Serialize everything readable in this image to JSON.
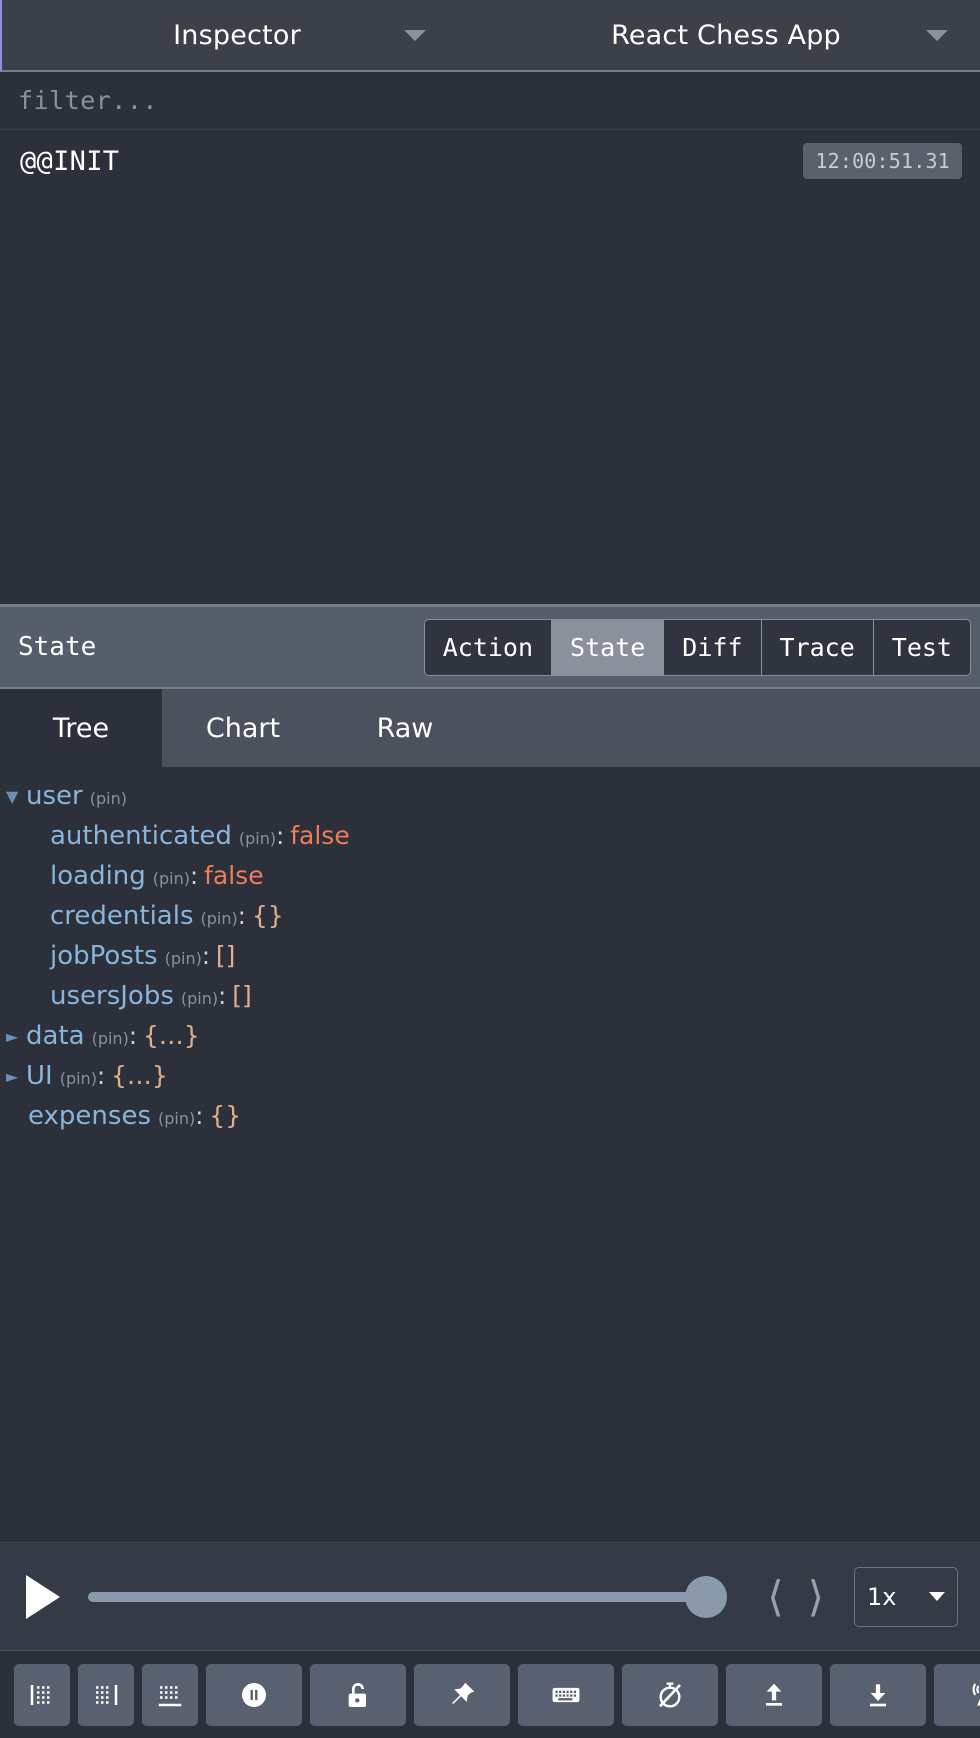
{
  "header": {
    "monitor_select": {
      "value": "Inspector",
      "icon": "chevron-down-icon"
    },
    "instance_select": {
      "value": "React Chess App",
      "icon": "chevron-down-icon"
    }
  },
  "filter": {
    "placeholder": "filter...",
    "value": ""
  },
  "actions": [
    {
      "name": "@@INIT",
      "time": "12:00:51.31"
    }
  ],
  "monitor": {
    "title": "State",
    "tabs": [
      {
        "label": "Action",
        "active": false
      },
      {
        "label": "State",
        "active": true
      },
      {
        "label": "Diff",
        "active": false
      },
      {
        "label": "Trace",
        "active": false
      },
      {
        "label": "Test",
        "active": false
      }
    ],
    "subtabs": [
      {
        "label": "Tree",
        "active": true
      },
      {
        "label": "Chart",
        "active": false
      },
      {
        "label": "Raw",
        "active": false
      }
    ]
  },
  "state_tree": {
    "pin_label": "(pin)",
    "colon": ":",
    "nodes": [
      {
        "key": "user",
        "level": 1,
        "arrow": "expanded",
        "value": ""
      },
      {
        "key": "authenticated",
        "level": 2,
        "arrow": "none",
        "value": "false",
        "type": "bool"
      },
      {
        "key": "loading",
        "level": 2,
        "arrow": "none",
        "value": "false",
        "type": "bool"
      },
      {
        "key": "credentials",
        "level": 2,
        "arrow": "none",
        "value": "{}",
        "type": "obj"
      },
      {
        "key": "jobPosts",
        "level": 2,
        "arrow": "none",
        "value": "[]",
        "type": "obj"
      },
      {
        "key": "usersJobs",
        "level": 2,
        "arrow": "none",
        "value": "[]",
        "type": "obj"
      },
      {
        "key": "data",
        "level": 1,
        "arrow": "collapsed",
        "value": "{…}",
        "type": "obj"
      },
      {
        "key": "UI",
        "level": 1,
        "arrow": "collapsed",
        "value": "{…}",
        "type": "obj"
      },
      {
        "key": "expenses",
        "level": 1,
        "arrow": "none",
        "value": "{}",
        "type": "obj"
      }
    ]
  },
  "player": {
    "play_icon": "play-icon",
    "slider": {
      "value": 100,
      "min": 0,
      "max": 100
    },
    "prev_icon": "chevron-left-icon",
    "next_icon": "chevron-right-icon",
    "speed": {
      "value": "1x",
      "icon": "chevron-down-icon"
    }
  },
  "toolbar": [
    {
      "name": "dock-left-button",
      "icon": "dock-left-icon",
      "size": "sm"
    },
    {
      "name": "dock-right-button",
      "icon": "dock-right-icon",
      "size": "sm"
    },
    {
      "name": "dock-bottom-button",
      "icon": "dock-bottom-icon",
      "size": "sm"
    },
    {
      "name": "pause-recording-button",
      "icon": "pause-circle-icon",
      "size": "md"
    },
    {
      "name": "lock-changes-button",
      "icon": "unlock-icon",
      "size": "md"
    },
    {
      "name": "pin-button",
      "icon": "pin-icon",
      "size": "md"
    },
    {
      "name": "keyboard-shortcuts-button",
      "icon": "keyboard-icon",
      "size": "md"
    },
    {
      "name": "disable-timer-button",
      "icon": "timer-off-icon",
      "size": "md"
    },
    {
      "name": "import-button",
      "icon": "upload-icon",
      "size": "md"
    },
    {
      "name": "export-button",
      "icon": "download-icon",
      "size": "md"
    },
    {
      "name": "remote-button",
      "icon": "broadcast-icon",
      "size": "md"
    },
    {
      "name": "settings-button",
      "icon": "gear-icon",
      "size": "md"
    }
  ],
  "colors": {
    "background": "#2b303b",
    "panel": "#343a46",
    "header": "#3b4049",
    "accent_border": "#8d8fe0",
    "key": "#8ab4d8",
    "bool_value": "#ef7d57",
    "object_value": "#dbb08c",
    "muted": "#8b919c",
    "button": "#596070"
  }
}
